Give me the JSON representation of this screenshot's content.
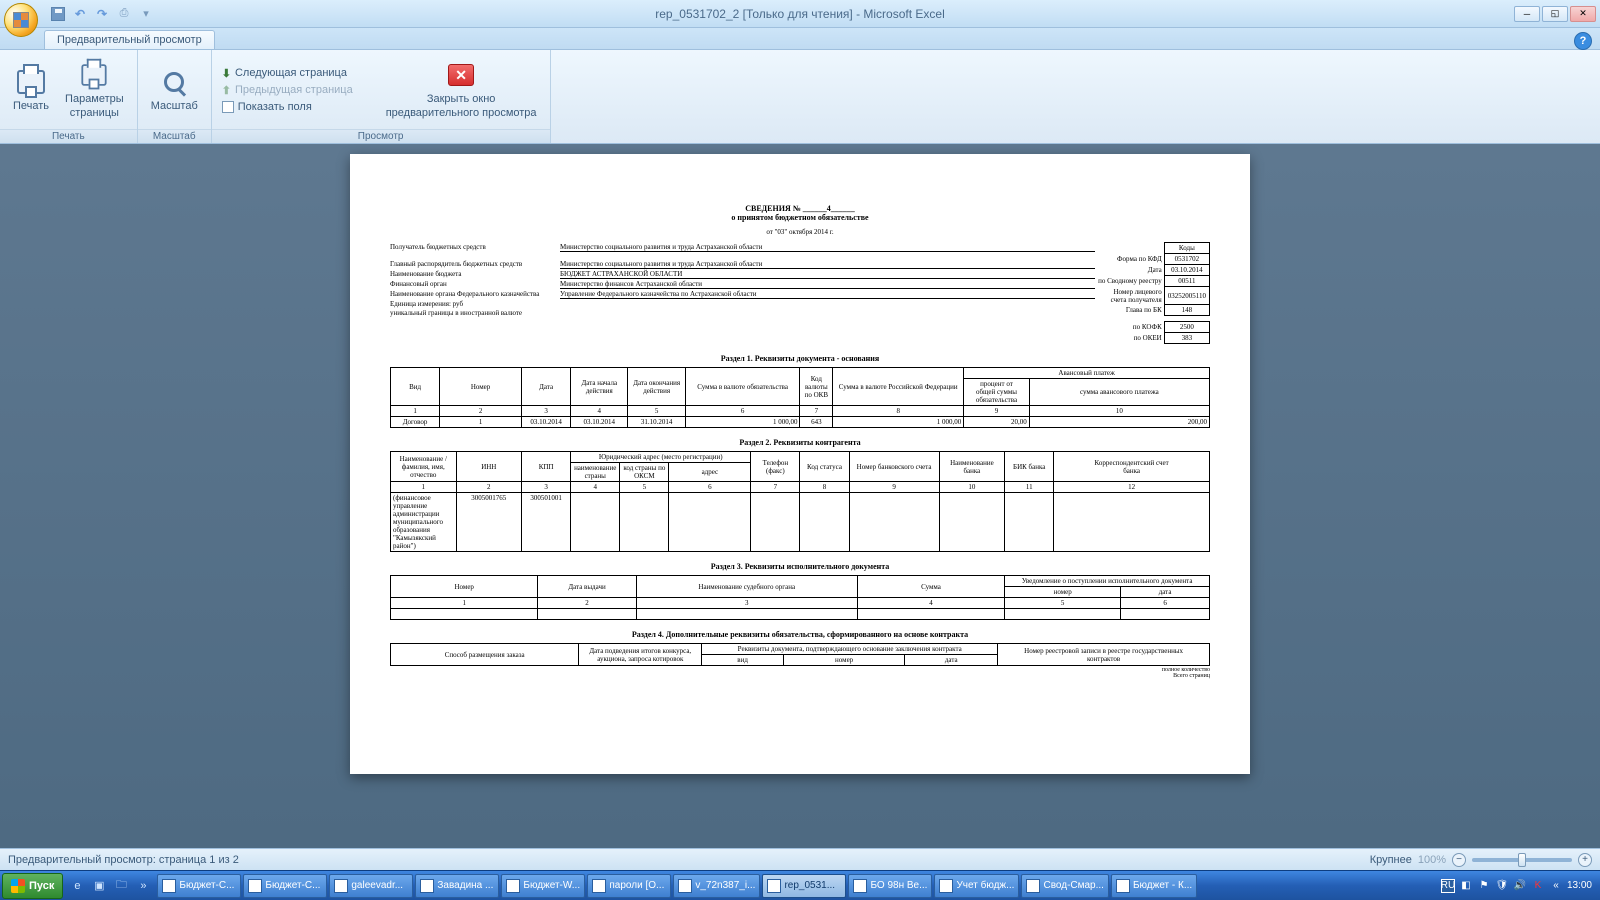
{
  "window": {
    "title": "rep_0531702_2 [Только для чтения] - Microsoft Excel",
    "tab": "Предварительный просмотр",
    "help": "?"
  },
  "ribbon": {
    "print_group": "Печать",
    "print_btn": "Печать",
    "page_setup_btn": "Параметры\nстраницы",
    "zoom_group": "Масштаб",
    "zoom_btn": "Масштаб",
    "view_group": "Просмотр",
    "next_page": "Следующая страница",
    "prev_page": "Предыдущая страница",
    "show_margins": "Показать поля",
    "close_btn": "Закрыть окно\nпредварительного просмотра"
  },
  "status": {
    "left": "Предварительный просмотр: страница 1 из 2",
    "larger": "Крупнее",
    "zoom": "100%"
  },
  "doc": {
    "title_line1": "СВЕДЕНИЯ № ______4______",
    "title_line2": "о принятом бюджетном обязательстве",
    "date_line": "от \"03\" октября 2014 г.",
    "meta": {
      "l1": "Получатель бюджетных средств",
      "v1": "Министерство социального развития и труда Астраханской области",
      "l2": "Главный распорядитель бюджетных средств",
      "v2": "Министерство социального развития и труда Астраханской области",
      "l3": "Наименование бюджета",
      "v3": "БЮДЖЕТ АСТРАХАНСКОЙ ОБЛАСТИ",
      "l4": "Финансовый орган",
      "v4": "Министерство финансов Астраханской области",
      "l5": "Наименование органа Федерального казначейства",
      "v5": "Управление Федерального казначейства по Астраханской области",
      "l6": "Единица измерения: руб",
      "l7": "уникальный границы в иностранной валюте"
    },
    "codes": {
      "head": "Коды",
      "r1l": "Форма по КФД",
      "r1": "0531702",
      "r2l": "Дата",
      "r2": "03.10.2014",
      "r3l": "по Сводному реестру",
      "r3": "00511",
      "r4l": "Номер лицевого\nсчета получателя",
      "r4": "03252005110",
      "r5l": "Глава по БК",
      "r5": "148",
      "r6l": "по КОФК",
      "r6": "2500",
      "r7l": "по ОКЕИ",
      "r7": "383"
    },
    "s1_title": "Раздел 1. Реквизиты документа - основания",
    "s1_headers": [
      "Вид",
      "Номер",
      "Дата",
      "Дата начала\nдействия",
      "Дата окончания\nдействия",
      "Сумма в валюте обязательства",
      "Код\nвалюты\nпо ОКВ",
      "Сумма в валюте Российской Федерации",
      "Авансовый платеж"
    ],
    "s1_sub": [
      "процент от\nобщей суммы\nобязательства",
      "сумма авансового платежа"
    ],
    "s1_nums": [
      "1",
      "2",
      "3",
      "4",
      "5",
      "6",
      "7",
      "8",
      "9",
      "10"
    ],
    "s1_row": [
      "Договор",
      "1",
      "03.10.2014",
      "03.10.2014",
      "31.10.2014",
      "1 000,00",
      "643",
      "1 000,00",
      "20,00",
      "200,00"
    ],
    "s2_title": "Раздел 2. Реквизиты контрагента",
    "s2_headers": [
      "Наименование /\nфамилия, имя,\nотчество",
      "ИНН",
      "КПП",
      "Юридический адрес (место регистрации)",
      "Телефон\n(факс)",
      "Код статуса",
      "Номер банковского счета",
      "Наименование\nбанка",
      "БИК банка",
      "Корреспондентский счет\nбанка"
    ],
    "s2_sub": [
      "наименование\nстраны",
      "код страны по\nОКСМ",
      "адрес"
    ],
    "s2_nums": [
      "1",
      "2",
      "3",
      "4",
      "5",
      "6",
      "7",
      "8",
      "9",
      "10",
      "11",
      "12"
    ],
    "s2_row": [
      "(финансовое\nуправление\nадминистрации\nмуниципального\nобразования\n\"Камызякский\nрайон\")",
      "3005001765",
      "300501001",
      "",
      "",
      "",
      "",
      "",
      "",
      "",
      "",
      ""
    ],
    "s3_title": "Раздел 3. Реквизиты исполнительного документа",
    "s3_headers": [
      "Номер",
      "Дата выдачи",
      "Наименование судебного органа",
      "Сумма",
      "Уведомление о поступлении исполнительного документа"
    ],
    "s3_sub": [
      "номер",
      "дата"
    ],
    "s3_nums": [
      "1",
      "2",
      "3",
      "4",
      "5",
      "6"
    ],
    "s4_title": "Раздел 4. Дополнительные реквизиты обязательства, сформированного на основе контракта",
    "s4_headers": [
      "Способ размещения заказа",
      "Дата подведения итогов конкурса,\nаукциона, запроса котировок",
      "Реквизиты документа, подтверждающего основание заключения контракта",
      "Номер реестровой записи в реестре государственных\nконтрактов"
    ],
    "s4_sub": [
      "вид",
      "номер",
      "дата"
    ],
    "footer1": "полное количество",
    "footer2": "Всего страниц"
  },
  "taskbar": {
    "start": "Пуск",
    "items": [
      {
        "label": "Бюджет-С...",
        "active": false
      },
      {
        "label": "Бюджет-С...",
        "active": false
      },
      {
        "label": "galeevadr...",
        "active": false
      },
      {
        "label": "Завадина ...",
        "active": false
      },
      {
        "label": "Бюджет-W...",
        "active": false
      },
      {
        "label": "пароли [O...",
        "active": false
      },
      {
        "label": "v_72n387_i...",
        "active": false
      },
      {
        "label": "rep_0531...",
        "active": true
      },
      {
        "label": "БО 98н Ве...",
        "active": false
      },
      {
        "label": "Учет бюдж...",
        "active": false
      },
      {
        "label": "Свод-Смар...",
        "active": false
      },
      {
        "label": "Бюджет - К...",
        "active": false
      }
    ],
    "lang": "RU",
    "time": "13:00"
  }
}
